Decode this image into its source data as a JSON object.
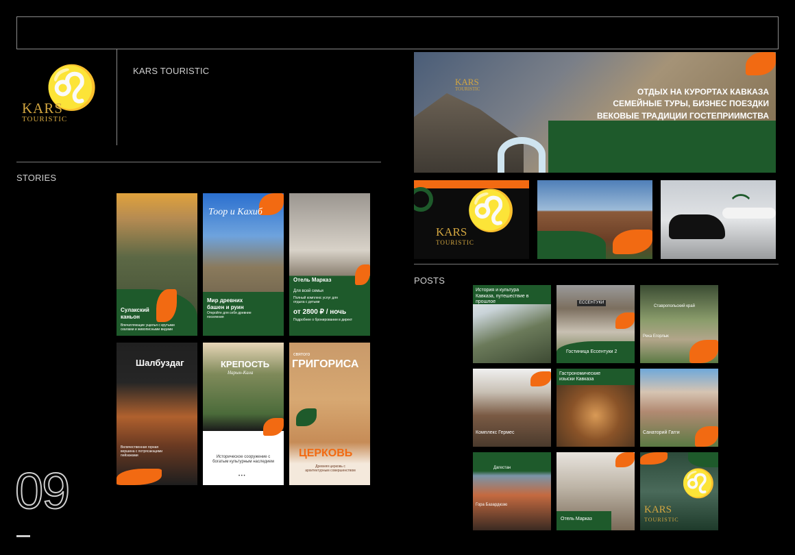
{
  "brand": {
    "name_line1": "KARS",
    "name_line2": "TOURISTIC",
    "header_title": "KARS TOURISTIC"
  },
  "sections": {
    "stories": "STORIES",
    "posts": "POSTS"
  },
  "page_number": "09",
  "banner": {
    "line1": "ОТДЫХ НА КУРОРТАХ КАВКАЗА",
    "line2": "СЕМЕЙНЫЕ ТУРЫ, БИЗНЕС ПОЕЗДКИ",
    "line3": "ВЕКОВЫЕ ТРАДИЦИИ ГОСТЕПРИИМСТВА",
    "logo_line1": "KARS",
    "logo_line2": "TOURISTIC"
  },
  "thumb_logo": {
    "line1": "KARS",
    "line2": "TOURISTIC"
  },
  "stories": [
    {
      "title": "Сулакский каньон",
      "text": "Впечатляющие ущелья с крутыми скалами и живописными видами"
    },
    {
      "title": "Тоор и Кахиб",
      "headline": "Мир древних башен и руин",
      "text": "Откройте для себя древние поселения"
    },
    {
      "title": "Отель Марказ",
      "subtitle": "Для всей семьи",
      "text": "Полный комплекс услуг для отдыха с детьми",
      "price": "от 2800 ₽ / ночь",
      "note": "Подробнее о бронировании в директ"
    },
    {
      "title": "Шалбуздаг",
      "text": "Величественная горная вершина с потрясающими пейзажами"
    },
    {
      "title": "КРЕПОСТЬ",
      "subtitle": "Нарын-Кала",
      "text": "Историческое сооружение с богатым культурным наследием",
      "dots": "• • •"
    },
    {
      "title_top": "святого",
      "title": "ГРИГОРИСА",
      "bottom": "ЦЕРКОВЬ",
      "text": "Древняя церковь с архитектурным совершенством"
    }
  ],
  "posts": [
    {
      "title": "История и культура",
      "text": "Кавказа, путешествие в прошлое"
    },
    {
      "title": "Гостиница Ессентуки 2",
      "sign": "ЕССЕНТУКИ"
    },
    {
      "title": "Ставропольский край",
      "subtitle": "Река Егорлык"
    },
    {
      "title": "Комплекс Гермес"
    },
    {
      "title": "Гастрономические изыски Кавказа"
    },
    {
      "title": "Санаторий Гагги"
    },
    {
      "title": "Дагестан",
      "subtitle": "Гора Базардюзю"
    },
    {
      "title": "Отель Марказ"
    },
    {
      "logo_line1": "KARS",
      "logo_line2": "TOURISTIC"
    }
  ],
  "colors": {
    "accent": "#f26a12",
    "brand_green": "#1e5a2b",
    "gold": "#c99a37"
  }
}
